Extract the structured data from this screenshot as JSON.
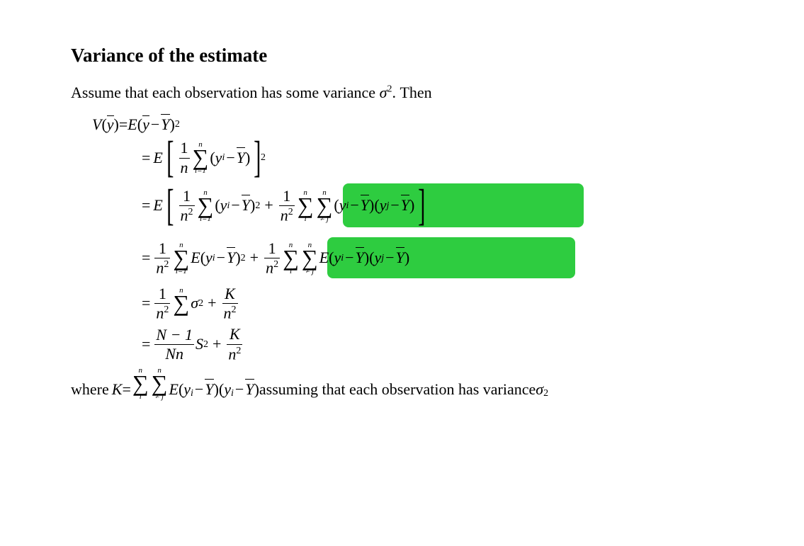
{
  "title": "Variance of the estimate",
  "intro_prefix": "Assume that each observation has some variance ",
  "intro_sigma": "σ",
  "intro_suffix": ". Then",
  "line1": {
    "V": "V",
    "ybar": "y",
    "eq": " = ",
    "E": "E",
    "Ybar": "Y",
    "sq": "2"
  },
  "frac": {
    "one": "1",
    "n": "n",
    "n2": "n",
    "n2sup": "2"
  },
  "sum": {
    "top_n": "n",
    "bot_i1": "i=1",
    "bot_i": "i",
    "bot_nej": "≠ j"
  },
  "terms": {
    "yi": "y",
    "i": "i",
    "j": "j",
    "Ybar": "Y",
    "sq": "2",
    "sigma": "σ",
    "K": "K",
    "Nm1": "N − 1",
    "Nn": "Nn",
    "S": "S"
  },
  "plus": "+",
  "minus": "−",
  "where": "where ",
  "K_def": "K",
  "assuming": " assuming that each observation has variance ",
  "highlight_color": "#2ecc40"
}
